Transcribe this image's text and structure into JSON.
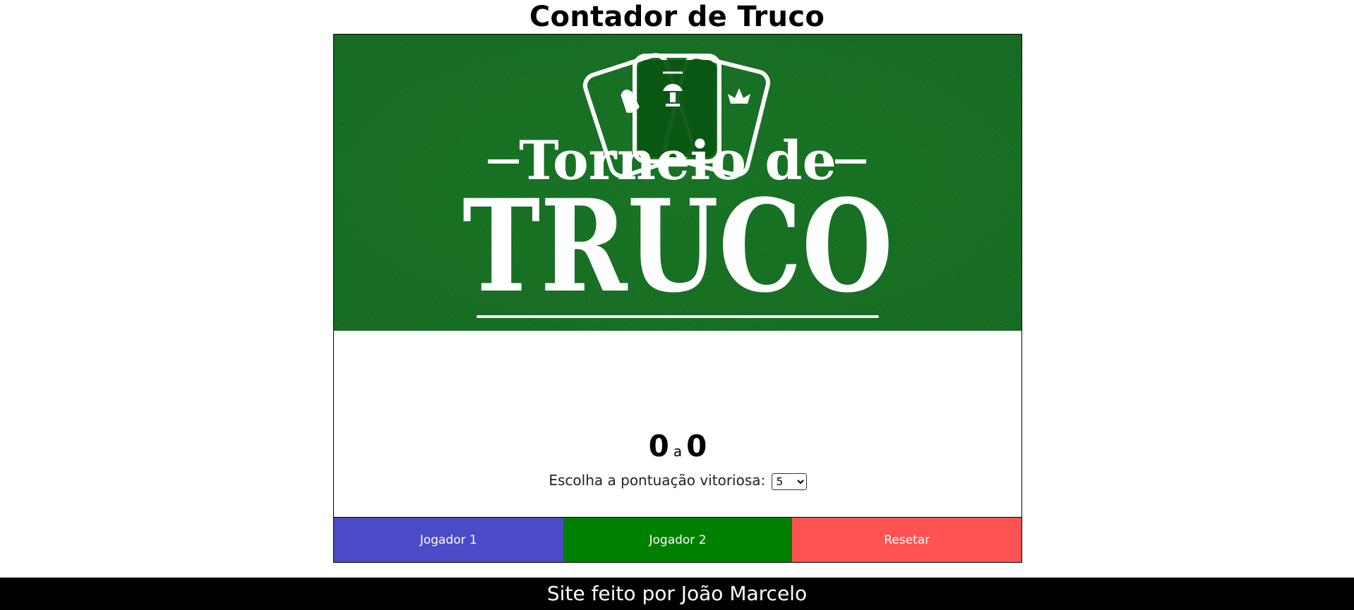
{
  "header": {
    "title": "Contador de Truco"
  },
  "banner": {
    "line1": "Torneio de",
    "line2": "TRUCO",
    "felt_color": "#0b5a12",
    "felt_dark": "#063a0a"
  },
  "scoreboard": {
    "player1_score": "0",
    "separator": "a",
    "player2_score": "0"
  },
  "victory": {
    "label": "Escolha a pontuação vitoriosa:",
    "selected": "5"
  },
  "buttons": {
    "player1": "Jogador 1",
    "player2": "Jogador 2",
    "reset": "Resetar"
  },
  "colors": {
    "player1": "#4b4bc8",
    "player2": "#008000",
    "reset": "#ff5252"
  },
  "footer": {
    "text": "Site feito por João Marcelo"
  }
}
